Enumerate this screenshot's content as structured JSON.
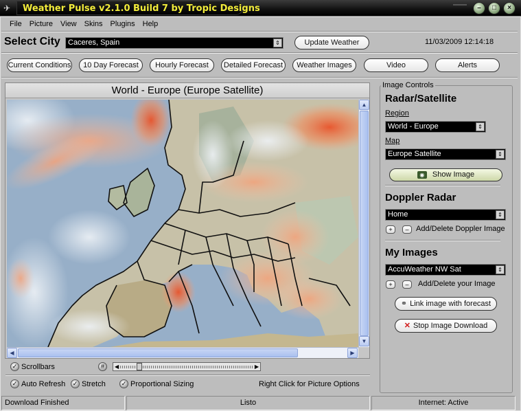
{
  "window": {
    "title": "Weather Pulse v2.1.0 Build 7 by Tropic Designs"
  },
  "menu": [
    "File",
    "Picture",
    "View",
    "Skins",
    "Plugins",
    "Help"
  ],
  "top": {
    "select_city_label": "Select City",
    "city_value": "Caceres, Spain",
    "update_button": "Update Weather",
    "datetime": "11/03/2009 12:14:18"
  },
  "tabs": [
    "Current Conditions",
    "10 Day Forecast",
    "Hourly Forecast",
    "Detailed Forecast",
    "Weather Images",
    "Video",
    "Alerts"
  ],
  "image_panel": {
    "title": "World - Europe (Europe Satellite)"
  },
  "options": {
    "scrollbars": "Scrollbars",
    "auto_refresh": "Auto Refresh",
    "stretch": "Stretch",
    "proportional": "Proportional Sizing",
    "right_click_hint": "Right Click for Picture Options"
  },
  "side": {
    "legend": "Image Controls",
    "radar_heading": "Radar/Satellite",
    "region_label": "Region",
    "region_value": "World - Europe",
    "map_label": "Map",
    "map_value": "Europe Satellite",
    "show_image": "Show Image",
    "doppler_heading": "Doppler Radar",
    "doppler_value": "Home",
    "doppler_add_delete": "Add/Delete Doppler Image",
    "my_images_heading": "My Images",
    "my_images_value": "AccuWeather NW Sat",
    "my_images_add_delete": "Add/Delete your Image",
    "link_image": "Link image with forecast",
    "stop_download": "Stop Image Download"
  },
  "status": {
    "left": "Download Finished",
    "middle": "Listo",
    "right": "Internet: Active"
  },
  "colors": {
    "title_text": "#f2ec3a",
    "titlebar": "#000000",
    "chrome": "#bdbdbd"
  }
}
